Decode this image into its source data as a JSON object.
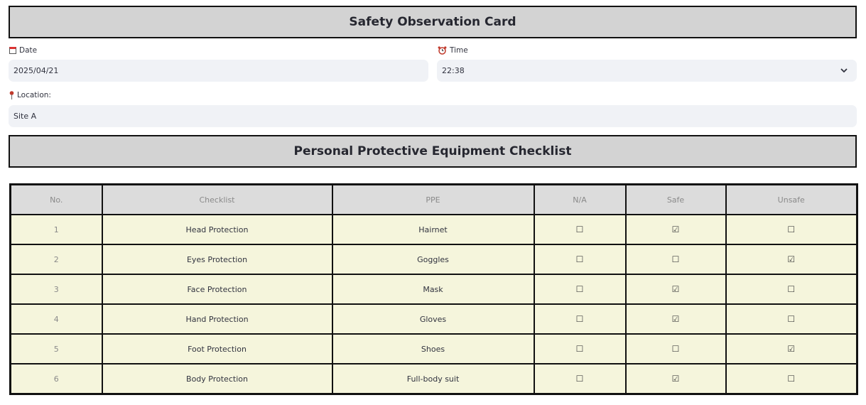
{
  "card_title": "Safety Observation Card",
  "date": {
    "label": "Date",
    "value": "2025/04/21",
    "icon": "calendar-icon"
  },
  "time": {
    "label": "Time",
    "value": "22:38",
    "icon": "alarm-clock-icon"
  },
  "location": {
    "label": "Location:",
    "value": "Site A",
    "icon": "pin-icon"
  },
  "checklist_title": "Personal Protective Equipment Checklist",
  "table": {
    "headers": [
      "No.",
      "Checklist",
      "PPE",
      "N/A",
      "Safe",
      "Unsafe"
    ],
    "rows": [
      {
        "no": "1",
        "checklist": "Head Protection",
        "ppe": "Hairnet",
        "na": "☐",
        "safe": "☑",
        "unsafe": "☐"
      },
      {
        "no": "2",
        "checklist": "Eyes Protection",
        "ppe": "Goggles",
        "na": "☐",
        "safe": "☐",
        "unsafe": "☑"
      },
      {
        "no": "3",
        "checklist": "Face Protection",
        "ppe": "Mask",
        "na": "☐",
        "safe": "☑",
        "unsafe": "☐"
      },
      {
        "no": "4",
        "checklist": "Hand Protection",
        "ppe": "Gloves",
        "na": "☐",
        "safe": "☑",
        "unsafe": "☐"
      },
      {
        "no": "5",
        "checklist": "Foot Protection",
        "ppe": "Shoes",
        "na": "☐",
        "safe": "☐",
        "unsafe": "☑"
      },
      {
        "no": "6",
        "checklist": "Body Protection",
        "ppe": "Full-body suit",
        "na": "☐",
        "safe": "☑",
        "unsafe": "☐"
      }
    ]
  },
  "colors": {
    "header_bg": "#d3d3d3",
    "table_header_bg": "#dcdcdc",
    "table_row_bg": "#f5f5dc",
    "input_bg": "#f0f2f6"
  }
}
